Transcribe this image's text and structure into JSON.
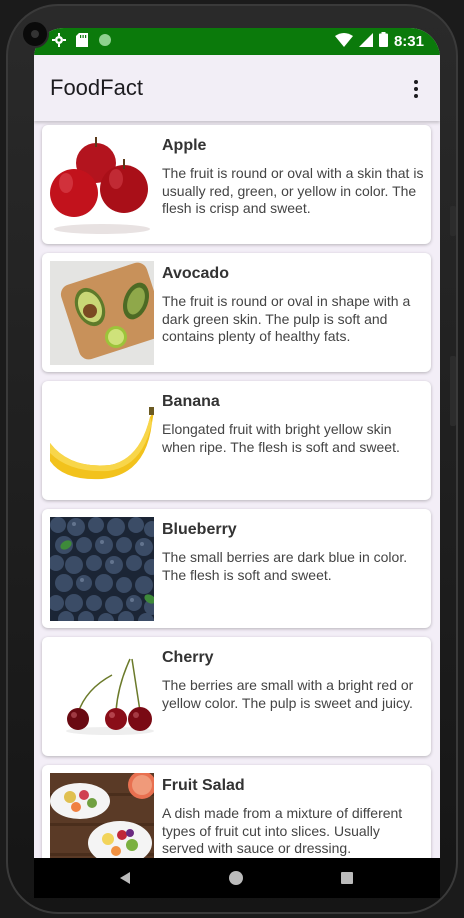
{
  "status": {
    "time": "8:31",
    "icons": [
      "settings-gear-icon",
      "sd-card-icon",
      "circle-indicator-icon",
      "wifi-icon",
      "signal-icon",
      "battery-icon"
    ],
    "bar_color": "#0b7a0b"
  },
  "appbar": {
    "title": "FoodFact",
    "menu_icon": "more-vert-icon"
  },
  "items": [
    {
      "name": "Apple",
      "description": "The fruit is round or oval with a skin that is usually red, green, or yellow in color. The flesh is crisp and sweet.",
      "image": "apple-image"
    },
    {
      "name": "Avocado",
      "description": "The fruit is round or oval in shape with a dark green skin. The pulp is soft and contains plenty of healthy fats.",
      "image": "avocado-image"
    },
    {
      "name": "Banana",
      "description": "Elongated fruit with bright yellow skin when ripe. The flesh is soft and sweet.",
      "image": "banana-image"
    },
    {
      "name": "Blueberry",
      "description": "The small berries are dark blue in color. The flesh is soft and sweet.",
      "image": "blueberry-image"
    },
    {
      "name": "Cherry",
      "description": "The berries are small with a bright red or yellow color. The pulp is sweet and juicy.",
      "image": "cherry-image"
    },
    {
      "name": "Fruit Salad",
      "description": "A dish made from a mixture of different types of fruit cut into slices. Usually served with sauce or dressing.",
      "image": "fruit-salad-image"
    }
  ],
  "navbar": {
    "icons": [
      "back-icon",
      "home-icon",
      "recents-icon"
    ]
  }
}
